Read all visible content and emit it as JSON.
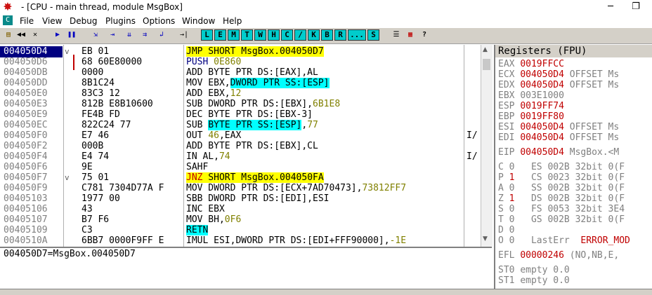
{
  "window": {
    "title": "- [CPU - main thread, module MsgBox]",
    "restore_glyph": "❐",
    "minimize_glyph": "─"
  },
  "menu": {
    "cpu_icon_label": "C",
    "items": [
      "File",
      "View",
      "Debug",
      "Plugins",
      "Options",
      "Window",
      "Help"
    ]
  },
  "toolbar": {
    "buttons": [
      "open",
      "rewind",
      "close-x",
      "run",
      "pause",
      "step-into",
      "step-over",
      "trace-into",
      "trace-over",
      "exec-till-return",
      "goto"
    ],
    "letters": [
      "L",
      "E",
      "M",
      "T",
      "W",
      "H",
      "C",
      "/",
      "K",
      "B",
      "R",
      "...",
      "S"
    ]
  },
  "disasm": {
    "rows": [
      {
        "addr": "004050D4",
        "hex": "EB 01",
        "marker": "v",
        "instr": [
          {
            "t": "JMP SHORT MsgBox.004050D7",
            "c": "hl-yellow"
          }
        ],
        "sel": true
      },
      {
        "addr": "004050D6",
        "hex": "68 60E80000",
        "instr": [
          {
            "t": "PUSH ",
            "c": "navy"
          },
          {
            "t": "0E860",
            "c": "olive"
          }
        ]
      },
      {
        "addr": "004050DB",
        "hex": "0000",
        "instr": [
          {
            "t": "ADD BYTE PTR DS:[EAX],AL"
          }
        ]
      },
      {
        "addr": "004050DD",
        "hex": "8B1C24",
        "instr": [
          {
            "t": "MOV EBX,"
          },
          {
            "t": "DWORD PTR SS:[ESP]",
            "c": "hl-cyan"
          }
        ]
      },
      {
        "addr": "004050E0",
        "hex": "83C3 12",
        "instr": [
          {
            "t": "ADD EBX,"
          },
          {
            "t": "12",
            "c": "olive"
          }
        ]
      },
      {
        "addr": "004050E3",
        "hex": "812B E8B10600",
        "instr": [
          {
            "t": "SUB DWORD PTR DS:[EBX],"
          },
          {
            "t": "6B1E8",
            "c": "olive"
          }
        ]
      },
      {
        "addr": "004050E9",
        "hex": "FE4B FD",
        "instr": [
          {
            "t": "DEC BYTE PTR DS:[EBX-3]"
          }
        ]
      },
      {
        "addr": "004050EC",
        "hex": "822C24 77",
        "instr": [
          {
            "t": "SUB "
          },
          {
            "t": "BYTE PTR SS:[ESP]",
            "c": "hl-cyan"
          },
          {
            "t": ","
          },
          {
            "t": "77",
            "c": "olive"
          }
        ]
      },
      {
        "addr": "004050F0",
        "hex": "E7 46",
        "instr": [
          {
            "t": "OUT "
          },
          {
            "t": "46",
            "c": "olive"
          },
          {
            "t": ",EAX"
          }
        ],
        "cmt": "I/"
      },
      {
        "addr": "004050F2",
        "hex": "000B",
        "instr": [
          {
            "t": "ADD BYTE PTR DS:[EBX],CL"
          }
        ]
      },
      {
        "addr": "004050F4",
        "hex": "E4 74",
        "instr": [
          {
            "t": "IN AL,"
          },
          {
            "t": "74",
            "c": "olive"
          }
        ],
        "cmt": "I/"
      },
      {
        "addr": "004050F6",
        "hex": "9E",
        "instr": [
          {
            "t": "SAHF"
          }
        ]
      },
      {
        "addr": "004050F7",
        "hex": "75 01",
        "marker": "v",
        "instr": [
          {
            "t": "JNZ",
            "c": "hl-yellow red"
          },
          {
            "t": " SHORT MsgBox.004050FA",
            "c": "hl-yellow"
          }
        ]
      },
      {
        "addr": "004050F9",
        "hex": "C781 7304D77A F",
        "instr": [
          {
            "t": "MOV DWORD PTR DS:[ECX+7AD70473],"
          },
          {
            "t": "73812FF7",
            "c": "olive"
          }
        ]
      },
      {
        "addr": "00405103",
        "hex": "1977 00",
        "instr": [
          {
            "t": "SBB DWORD PTR DS:[EDI],ESI"
          }
        ]
      },
      {
        "addr": "00405106",
        "hex": "43",
        "instr": [
          {
            "t": "INC EBX"
          }
        ]
      },
      {
        "addr": "00405107",
        "hex": "B7 F6",
        "instr": [
          {
            "t": "MOV BH,"
          },
          {
            "t": "0F6",
            "c": "olive"
          }
        ]
      },
      {
        "addr": "00405109",
        "hex": "C3",
        "instr": [
          {
            "t": "RETN",
            "c": "hl-cyan"
          }
        ]
      },
      {
        "addr": "0040510A",
        "hex": "6BB7 0000F9FF E",
        "instr": [
          {
            "t": "IMUL ESI,DWORD PTR DS:[EDI+FFF90000],"
          },
          {
            "t": "-1E",
            "c": "olive"
          }
        ]
      }
    ]
  },
  "info": {
    "line": "004050D7=MsgBox.004050D7"
  },
  "registers": {
    "header": "Registers (FPU)",
    "rows": [
      {
        "name": "EAX",
        "value": "0019FFCC",
        "note": ""
      },
      {
        "name": "ECX",
        "value": "004050D4",
        "note": "OFFSET Ms"
      },
      {
        "name": "EDX",
        "value": "004050D4",
        "note": "OFFSET Ms"
      },
      {
        "name": "EBX",
        "value": "003E1000",
        "note": "",
        "plain": true
      },
      {
        "name": "ESP",
        "value": "0019FF74",
        "note": ""
      },
      {
        "name": "EBP",
        "value": "0019FF80",
        "note": ""
      },
      {
        "name": "ESI",
        "value": "004050D4",
        "note": "OFFSET Ms"
      },
      {
        "name": "EDI",
        "value": "004050D4",
        "note": "OFFSET Ms"
      }
    ],
    "eip": {
      "name": "EIP",
      "value": "004050D4",
      "note": "MsgBox.<M"
    },
    "flags": [
      {
        "f": "C",
        "v": "0",
        "seg": "ES",
        "sel": "002B",
        "desc": "32bit 0(F"
      },
      {
        "f": "P",
        "v": "1",
        "seg": "CS",
        "sel": "0023",
        "desc": "32bit 0(F",
        "changed": true
      },
      {
        "f": "A",
        "v": "0",
        "seg": "SS",
        "sel": "002B",
        "desc": "32bit 0(F"
      },
      {
        "f": "Z",
        "v": "1",
        "seg": "DS",
        "sel": "002B",
        "desc": "32bit 0(F",
        "changed": true
      },
      {
        "f": "S",
        "v": "0",
        "seg": "FS",
        "sel": "0053",
        "desc": "32bit 3E4"
      },
      {
        "f": "T",
        "v": "0",
        "seg": "GS",
        "sel": "002B",
        "desc": "32bit 0(F"
      },
      {
        "f": "D",
        "v": "0",
        "seg": "",
        "sel": "",
        "desc": ""
      },
      {
        "f": "O",
        "v": "0",
        "seg": "LastErr",
        "sel": "",
        "desc": "ERROR_MOD"
      }
    ],
    "efl": {
      "name": "EFL",
      "value": "00000246",
      "note": "(NO,NB,E,"
    },
    "st": [
      {
        "name": "ST0",
        "value": "empty 0.0"
      },
      {
        "name": "ST1",
        "value": "empty 0.0"
      }
    ]
  }
}
